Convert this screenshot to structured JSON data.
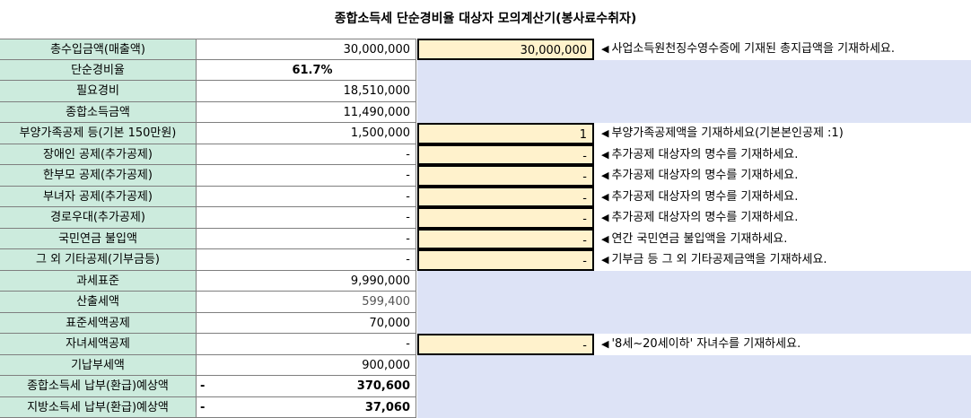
{
  "title": "종합소득세 단순경비율 대상자 모의계산기(봉사료수취자)",
  "rows": [
    {
      "label": "총수입금액(매출액)",
      "value": "30,000,000",
      "input": "30,000,000",
      "note": "사업소득원천징수영수증에 기재된 총지급액을 기재하세요."
    },
    {
      "label": "단순경비율",
      "value": "61.7%"
    },
    {
      "label": "필요경비",
      "value": "18,510,000"
    },
    {
      "label": "종합소득금액",
      "value": "11,490,000"
    },
    {
      "label": "부양가족공제 등(기본 150만원)",
      "value": "1,500,000",
      "input": "1",
      "note": "부양가족공제액을 기재하세요(기본본인공제 :1)"
    },
    {
      "label": "장애인 공제(추가공제)",
      "value": "-",
      "input": "-",
      "note": "추가공제 대상자의 명수를 기재하세요."
    },
    {
      "label": "한부모 공제(추가공제)",
      "value": "-",
      "input": "-",
      "note": "추가공제 대상자의 명수를 기재하세요."
    },
    {
      "label": "부녀자 공제(추가공제)",
      "value": "-",
      "input": "-",
      "note": "추가공제 대상자의 명수를 기재하세요."
    },
    {
      "label": "경로우대(추가공제)",
      "value": "-",
      "input": "-",
      "note": "추가공제 대상자의 명수를 기재하세요."
    },
    {
      "label": "국민연금 불입액",
      "value": "-",
      "input": "-",
      "note": "연간 국민연금 불입액을 기재하세요."
    },
    {
      "label": "그 외 기타공제(기부금등)",
      "value": "-",
      "input": "-",
      "note": "기부금 등 그 외 기타공제금액을 기재하세요."
    },
    {
      "label": "과세표준",
      "value": "9,990,000"
    },
    {
      "label": "산출세액",
      "value": "599,400"
    },
    {
      "label": "표준세액공제",
      "value": "70,000"
    },
    {
      "label": "자녀세액공제",
      "value": "-",
      "input": "-",
      "note": "'8세~20세이하' 자녀수를 기재하세요."
    },
    {
      "label": "기납부세액",
      "value": "900,000"
    },
    {
      "label": "종합소득세 납부(환급)예상액",
      "value_prefix": "-",
      "value": "370,600"
    },
    {
      "label": "지방소득세 납부(환급)예상액",
      "value_prefix": "-",
      "value": "37,060"
    }
  ],
  "arrow_symbol": "◀",
  "colors": {
    "label_bg": "#ccebdd",
    "input_bg": "#fff2cc",
    "blank_bg": "#dde3f6"
  }
}
